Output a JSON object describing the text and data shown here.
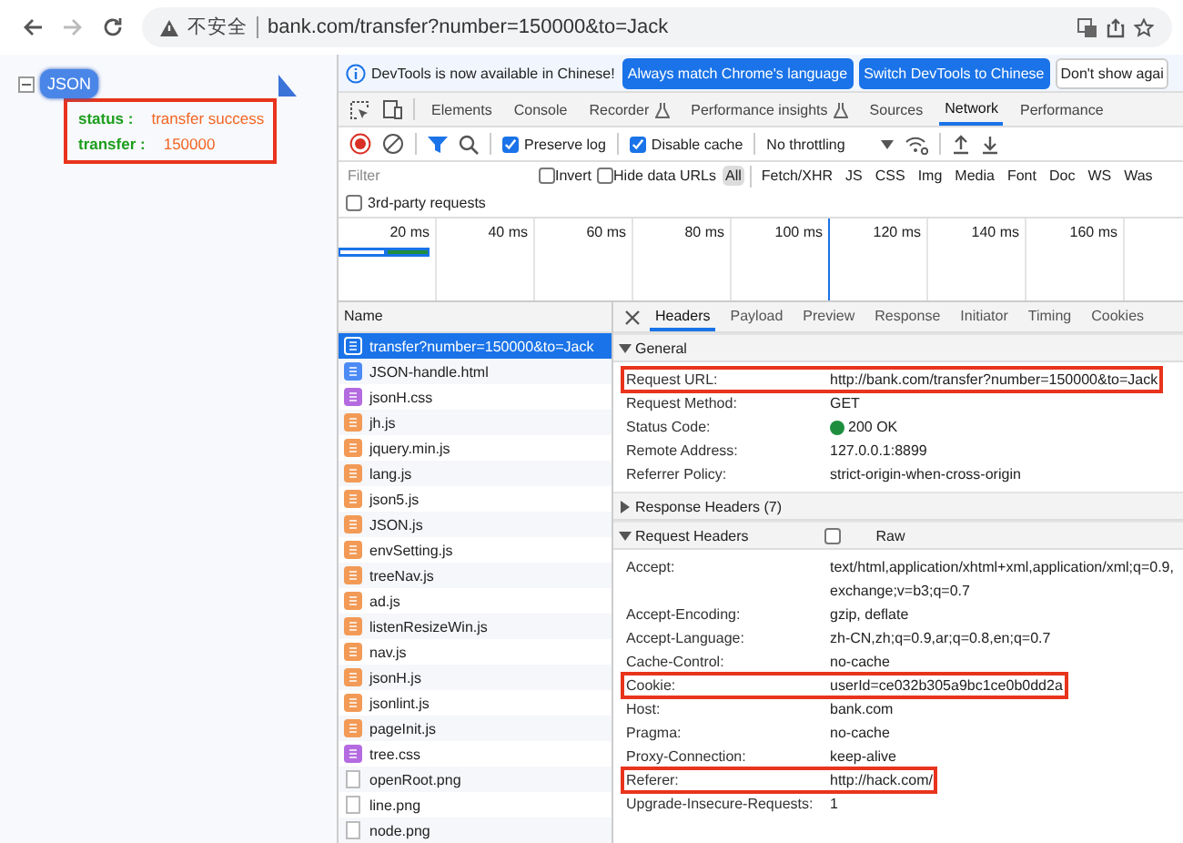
{
  "browser": {
    "security_label": "不安全",
    "url": "bank.com/transfer?number=150000&to=Jack"
  },
  "page": {
    "root_label": "JSON",
    "expanded": true,
    "fields": [
      {
        "key": "status :",
        "value": "transfer success"
      },
      {
        "key": "transfer :",
        "value": "150000"
      }
    ]
  },
  "devtools": {
    "infobar": {
      "message": "DevTools is now available in Chinese!",
      "buttons": [
        {
          "label": "Always match Chrome's language",
          "kind": "primary"
        },
        {
          "label": "Switch DevTools to Chinese",
          "kind": "primary"
        },
        {
          "label": "Don't show agai",
          "kind": "plain"
        }
      ]
    },
    "tabs": [
      {
        "label": "Elements",
        "selected": false,
        "experimental": false
      },
      {
        "label": "Console",
        "selected": false,
        "experimental": false
      },
      {
        "label": "Recorder",
        "selected": false,
        "experimental": true
      },
      {
        "label": "Performance insights",
        "selected": false,
        "experimental": true
      },
      {
        "label": "Sources",
        "selected": false,
        "experimental": false
      },
      {
        "label": "Network",
        "selected": true,
        "experimental": false
      },
      {
        "label": "Performance",
        "selected": false,
        "experimental": false
      }
    ],
    "toolbar": {
      "recording": true,
      "checkboxes": [
        {
          "label": "Preserve log",
          "checked": true
        },
        {
          "label": "Disable cache",
          "checked": true
        }
      ],
      "throttling": "No throttling"
    },
    "filter": {
      "placeholder": "Filter",
      "checkboxes": [
        {
          "label": "Invert",
          "checked": false
        },
        {
          "label": "Hide data URLs",
          "checked": false
        }
      ],
      "types": [
        {
          "label": "All",
          "selected": true
        },
        {
          "label": "Fetch/XHR",
          "selected": false
        },
        {
          "label": "JS",
          "selected": false
        },
        {
          "label": "CSS",
          "selected": false
        },
        {
          "label": "Img",
          "selected": false
        },
        {
          "label": "Media",
          "selected": false
        },
        {
          "label": "Font",
          "selected": false
        },
        {
          "label": "Doc",
          "selected": false
        },
        {
          "label": "WS",
          "selected": false
        },
        {
          "label": "Was",
          "selected": false
        }
      ],
      "third_party": {
        "label": "3rd-party requests",
        "checked": false
      }
    },
    "timeline": {
      "ticks": [
        "20 ms",
        "40 ms",
        "60 ms",
        "80 ms",
        "100 ms",
        "120 ms",
        "140 ms",
        "160 ms"
      ]
    },
    "requests": {
      "column": "Name",
      "rows": [
        {
          "name": "transfer?number=150000&to=Jack",
          "kind": "document",
          "selected": true
        },
        {
          "name": "JSON-handle.html",
          "kind": "document",
          "selected": false
        },
        {
          "name": "jsonH.css",
          "kind": "stylesheet",
          "selected": false
        },
        {
          "name": "jh.js",
          "kind": "script",
          "selected": false
        },
        {
          "name": "jquery.min.js",
          "kind": "script",
          "selected": false
        },
        {
          "name": "lang.js",
          "kind": "script",
          "selected": false
        },
        {
          "name": "json5.js",
          "kind": "script",
          "selected": false
        },
        {
          "name": "JSON.js",
          "kind": "script",
          "selected": false
        },
        {
          "name": "envSetting.js",
          "kind": "script",
          "selected": false
        },
        {
          "name": "treeNav.js",
          "kind": "script",
          "selected": false
        },
        {
          "name": "ad.js",
          "kind": "script",
          "selected": false
        },
        {
          "name": "listenResizeWin.js",
          "kind": "script",
          "selected": false
        },
        {
          "name": "nav.js",
          "kind": "script",
          "selected": false
        },
        {
          "name": "jsonH.js",
          "kind": "script",
          "selected": false
        },
        {
          "name": "jsonlint.js",
          "kind": "script",
          "selected": false
        },
        {
          "name": "pageInit.js",
          "kind": "script",
          "selected": false
        },
        {
          "name": "tree.css",
          "kind": "stylesheet",
          "selected": false
        },
        {
          "name": "openRoot.png",
          "kind": "image",
          "selected": false
        },
        {
          "name": "line.png",
          "kind": "image",
          "selected": false
        },
        {
          "name": "node.png",
          "kind": "image",
          "selected": false
        }
      ]
    },
    "detail": {
      "tabs": [
        {
          "label": "Headers",
          "selected": true
        },
        {
          "label": "Payload",
          "selected": false
        },
        {
          "label": "Preview",
          "selected": false
        },
        {
          "label": "Response",
          "selected": false
        },
        {
          "label": "Initiator",
          "selected": false
        },
        {
          "label": "Timing",
          "selected": false
        },
        {
          "label": "Cookies",
          "selected": false
        }
      ],
      "sections": [
        {
          "title": "General",
          "expanded": true,
          "rows": [
            {
              "label": "Request URL:",
              "value": "http://bank.com/transfer?number=150000&to=Jack",
              "highlighted": true,
              "kind": "text"
            },
            {
              "label": "Request Method:",
              "value": "GET",
              "highlighted": false,
              "kind": "text"
            },
            {
              "label": "Status Code:",
              "value": "200 OK",
              "highlighted": false,
              "kind": "status"
            },
            {
              "label": "Remote Address:",
              "value": "127.0.0.1:8899",
              "highlighted": false,
              "kind": "text"
            },
            {
              "label": "Referrer Policy:",
              "value": "strict-origin-when-cross-origin",
              "highlighted": false,
              "kind": "text"
            }
          ]
        },
        {
          "title": "Response Headers (7)",
          "expanded": false
        },
        {
          "title": "Request Headers",
          "expanded": true,
          "raw": {
            "label": "Raw",
            "checked": false
          },
          "rows": [
            {
              "label": "Accept:",
              "value": "text/html,application/xhtml+xml,application/xml;q=0.9,",
              "continuation": "exchange;v=b3;q=0.7",
              "highlighted": false,
              "kind": "text"
            },
            {
              "label": "Accept-Encoding:",
              "value": "gzip, deflate",
              "highlighted": false,
              "kind": "text"
            },
            {
              "label": "Accept-Language:",
              "value": "zh-CN,zh;q=0.9,ar;q=0.8,en;q=0.7",
              "highlighted": false,
              "kind": "text"
            },
            {
              "label": "Cache-Control:",
              "value": "no-cache",
              "highlighted": false,
              "kind": "text"
            },
            {
              "label": "Cookie:",
              "value": "userId=ce032b305a9bc1ce0b0dd2a",
              "highlighted": true,
              "kind": "text"
            },
            {
              "label": "Host:",
              "value": "bank.com",
              "highlighted": false,
              "kind": "text"
            },
            {
              "label": "Pragma:",
              "value": "no-cache",
              "highlighted": false,
              "kind": "text"
            },
            {
              "label": "Proxy-Connection:",
              "value": "keep-alive",
              "highlighted": false,
              "kind": "text"
            },
            {
              "label": "Referer:",
              "value": "http://hack.com/",
              "highlighted": true,
              "kind": "text"
            },
            {
              "label": "Upgrade-Insecure-Requests:",
              "value": "1",
              "highlighted": false,
              "kind": "text"
            }
          ]
        }
      ]
    }
  }
}
